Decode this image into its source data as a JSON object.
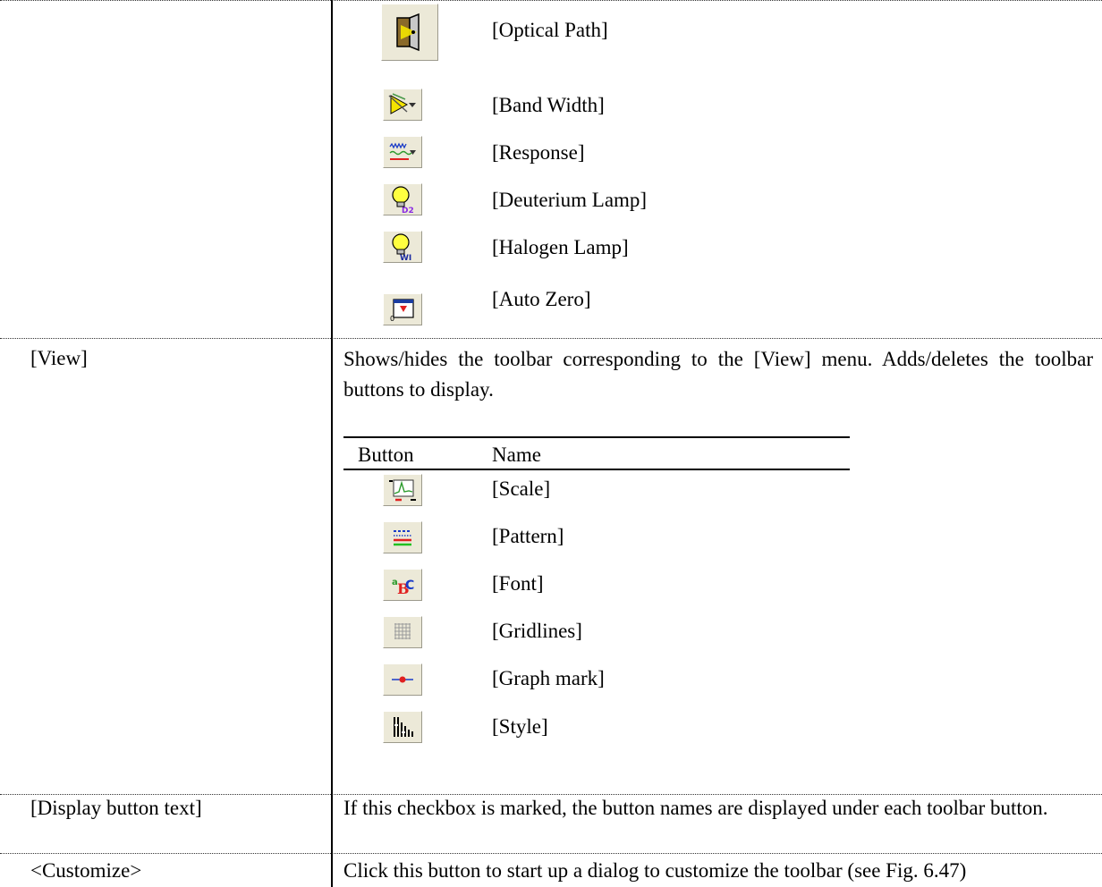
{
  "sections": {
    "measure": {
      "buttons": [
        {
          "icon": "optical-path-icon",
          "name": "[Optical Path]"
        },
        {
          "icon": "band-width-icon",
          "name": "[Band Width]"
        },
        {
          "icon": "response-icon",
          "name": "[Response]"
        },
        {
          "icon": "deuterium-lamp-icon",
          "name": "[Deuterium Lamp]"
        },
        {
          "icon": "halogen-lamp-icon",
          "name": "[Halogen Lamp]"
        },
        {
          "icon": "auto-zero-icon",
          "name": "[Auto Zero]"
        }
      ]
    },
    "view": {
      "label": "[View]",
      "description": "Shows/hides the toolbar corresponding to the [View] menu. Adds/deletes the toolbar buttons to display.",
      "table_headers": {
        "button": "Button",
        "name": "Name"
      },
      "buttons": [
        {
          "icon": "scale-icon",
          "name": "[Scale]"
        },
        {
          "icon": "pattern-icon",
          "name": "[Pattern]"
        },
        {
          "icon": "font-icon",
          "name": "[Font]"
        },
        {
          "icon": "gridlines-icon",
          "name": "[Gridlines]"
        },
        {
          "icon": "graph-mark-icon",
          "name": "[Graph mark]"
        },
        {
          "icon": "style-icon",
          "name": "[Style]"
        }
      ]
    },
    "display_text": {
      "label": "[Display button text]",
      "description": "If this checkbox is marked, the button names are displayed under each toolbar button."
    },
    "customize": {
      "label": "<Customize>",
      "description": "Click this button to start up a dialog to customize the toolbar (see Fig. 6.47)"
    }
  },
  "colors": {
    "button_face": "#ece9d8",
    "rule": "#000000"
  }
}
